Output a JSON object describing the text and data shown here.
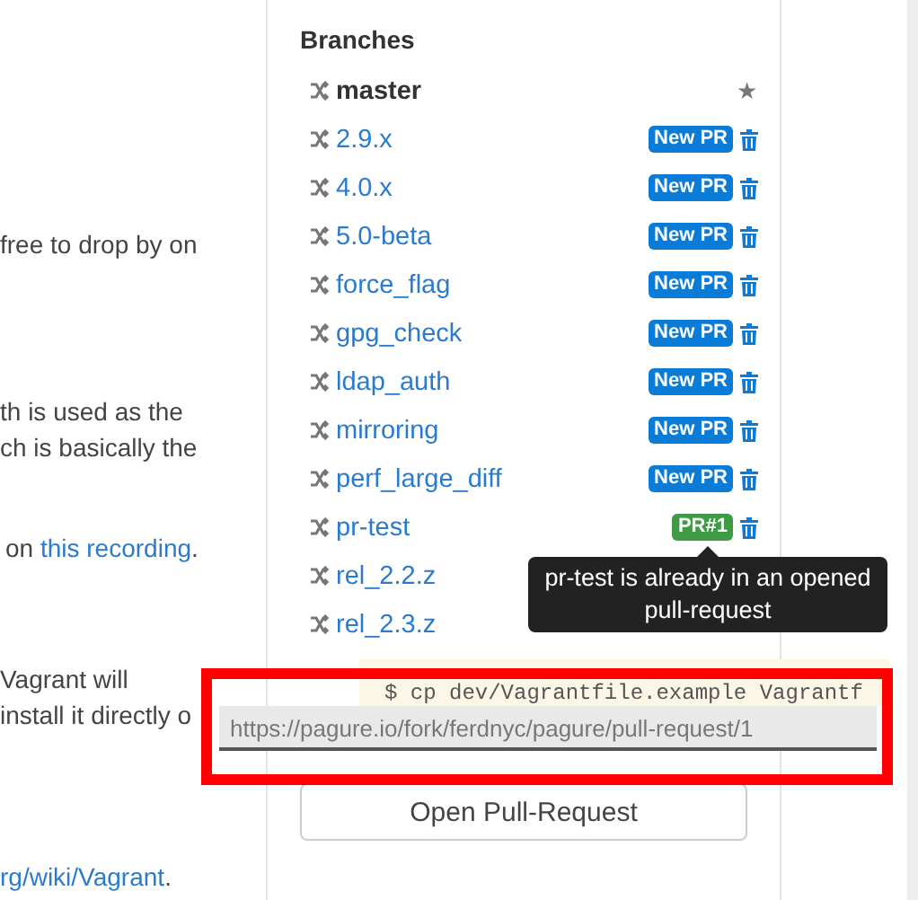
{
  "content_lines": [
    {
      "parts": [
        {
          "text": "free to drop by on",
          "kind": "text"
        }
      ]
    },
    {
      "parts": [
        {
          "text": "th is used as the",
          "kind": "text"
        }
      ]
    },
    {
      "parts": [
        {
          "text": "ch is basically the",
          "kind": "text"
        }
      ]
    },
    {
      "parts": [
        {
          "text": "on ",
          "kind": "text"
        },
        {
          "text": "this recording",
          "kind": "link"
        },
        {
          "text": ".",
          "kind": "text"
        }
      ]
    },
    {
      "parts": [
        {
          "text": "Vagrant will",
          "kind": "text"
        }
      ]
    },
    {
      "parts": [
        {
          "text": "install it directly o",
          "kind": "text"
        }
      ]
    },
    {
      "parts": [
        {
          "text": "rg/wiki/Vagrant",
          "kind": "link"
        },
        {
          "text": ".",
          "kind": "text"
        }
      ]
    }
  ],
  "sidebar": {
    "title": "Branches",
    "branches": [
      {
        "name": "master",
        "default": true,
        "star": "★",
        "deletable": false
      },
      {
        "name": "2.9.x",
        "default": false,
        "action": {
          "kind": "new_pr",
          "label": "New PR"
        },
        "deletable": true
      },
      {
        "name": "4.0.x",
        "default": false,
        "action": {
          "kind": "new_pr",
          "label": "New PR"
        },
        "deletable": true
      },
      {
        "name": "5.0-beta",
        "default": false,
        "action": {
          "kind": "new_pr",
          "label": "New PR"
        },
        "deletable": true
      },
      {
        "name": "force_flag",
        "default": false,
        "action": {
          "kind": "new_pr",
          "label": "New PR"
        },
        "deletable": true
      },
      {
        "name": "gpg_check",
        "default": false,
        "action": {
          "kind": "new_pr",
          "label": "New PR"
        },
        "deletable": true
      },
      {
        "name": "ldap_auth",
        "default": false,
        "action": {
          "kind": "new_pr",
          "label": "New PR"
        },
        "deletable": true
      },
      {
        "name": "mirroring",
        "default": false,
        "action": {
          "kind": "new_pr",
          "label": "New PR"
        },
        "deletable": true
      },
      {
        "name": "perf_large_diff",
        "default": false,
        "action": {
          "kind": "new_pr",
          "label": "New PR"
        },
        "deletable": true
      },
      {
        "name": "pr-test",
        "default": false,
        "action": {
          "kind": "open_pr",
          "label": "PR#1"
        },
        "deletable": true
      },
      {
        "name": "rel_2.2.z",
        "default": false,
        "deletable": false
      },
      {
        "name": "rel_2.3.z",
        "default": false,
        "deletable": false
      }
    ],
    "button": "Open Pull-Request"
  },
  "tooltip": {
    "text": "pr-test is already in an opened pull-request"
  },
  "code_block": {
    "text": "$ cp dev/Vagrantfile.example Vagrantf"
  },
  "status_url": "https://pagure.io/fork/ferdnyc/pagure/pull-request/1"
}
